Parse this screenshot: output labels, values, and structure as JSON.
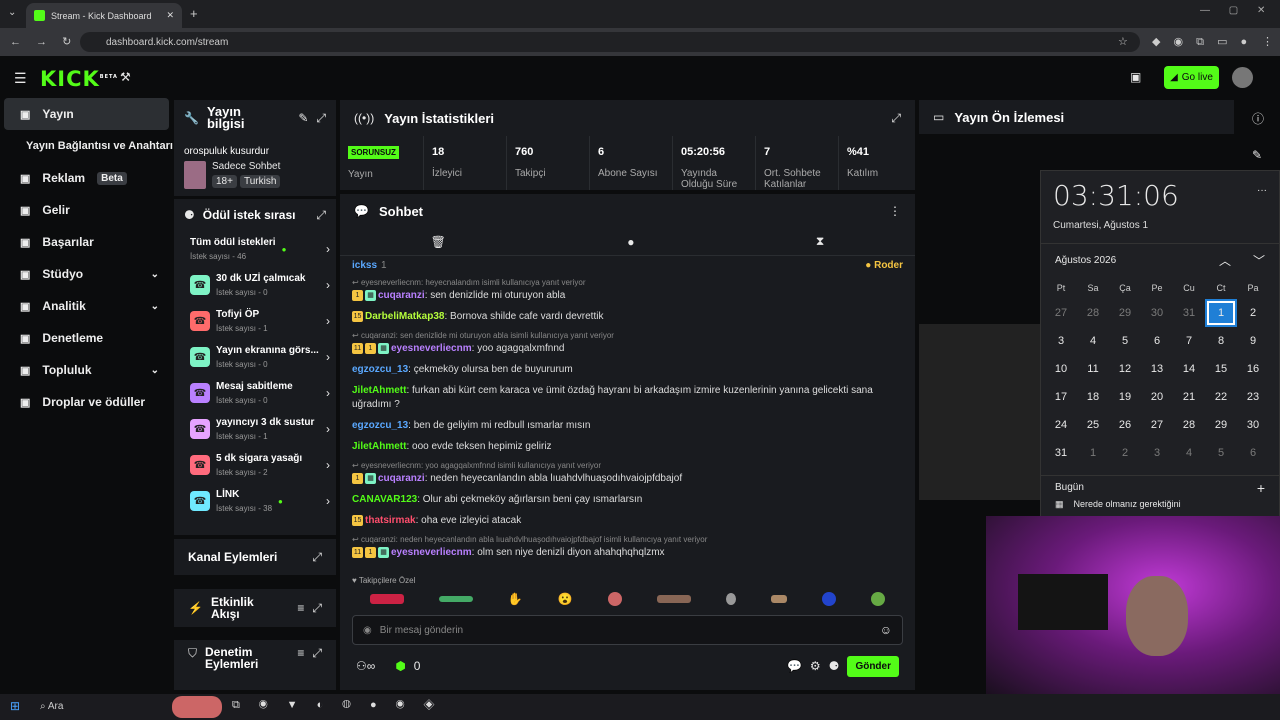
{
  "browser": {
    "tab_title": "Stream - Kick Dashboard",
    "url": "dashboard.kick.com/stream"
  },
  "header": {
    "logo": "KICK",
    "logo_sup": "BETA",
    "go_live": "Go live"
  },
  "nav": {
    "items": [
      {
        "label": "Yayın",
        "icon": "broadcast-icon",
        "active": true
      },
      {
        "label": "Yayın Bağlantısı ve Anahtarı",
        "icon": "",
        "sub": true
      },
      {
        "label": "Reklam",
        "icon": "ad-icon",
        "badge": "Beta"
      },
      {
        "label": "Gelir",
        "icon": "revenue-icon"
      },
      {
        "label": "Başarılar",
        "icon": "trophy-icon"
      },
      {
        "label": "Stüdyo",
        "icon": "studio-icon",
        "chevron": true
      },
      {
        "label": "Analitik",
        "icon": "analytics-icon",
        "chevron": true
      },
      {
        "label": "Denetleme",
        "icon": "wrench-icon"
      },
      {
        "label": "Topluluk",
        "icon": "community-icon",
        "chevron": true
      },
      {
        "label": "Droplar ve ödüller",
        "icon": "drops-icon"
      }
    ]
  },
  "stream_info": {
    "title": "Yayın bilgisi",
    "stream_title": "orospuluk kusurdur",
    "category": "Sadece Sohbet",
    "tags": [
      "18+",
      "Turkish"
    ]
  },
  "rewards": {
    "title": "Ödül istek sırası",
    "items": [
      {
        "name": "Tüm ödül istekleri",
        "sub": "İstek sayısı - 46",
        "color": "",
        "dot": true
      },
      {
        "name": "30 dk UZİ çalmıcak",
        "sub": "İstek sayısı - 0",
        "color": "#7ef3c5"
      },
      {
        "name": "Tofiyi ÖP",
        "sub": "İstek sayısı - 1",
        "color": "#ff6b6b"
      },
      {
        "name": "Yayın ekranına görs...",
        "sub": "İstek sayısı - 0",
        "color": "#7ef3c5"
      },
      {
        "name": "Mesaj sabitleme",
        "sub": "İstek sayısı - 0",
        "color": "#b980ff"
      },
      {
        "name": "yayıncıyı 3 dk sustur",
        "sub": "İstek sayısı - 1",
        "color": "#e6a3ff"
      },
      {
        "name": "5 dk sigara yasağı",
        "sub": "İstek sayısı - 2",
        "color": "#ff6b7d"
      },
      {
        "name": "LİNK",
        "sub": "İstek sayısı - 38",
        "color": "#6fe9ff",
        "dot": true
      }
    ]
  },
  "channel_actions": {
    "title": "Kanal Eylemleri"
  },
  "activity": {
    "title": "Etkinlik Akışı"
  },
  "moderation": {
    "title": "Denetim Eylemleri"
  },
  "stats": {
    "title": "Yayın İstatistikleri",
    "items": [
      {
        "value": "SORUNSUZ",
        "label": "Yayın"
      },
      {
        "value": "18",
        "label": "İzleyici"
      },
      {
        "value": "760",
        "label": "Takipçi"
      },
      {
        "value": "6",
        "label": "Abone Sayısı"
      },
      {
        "value": "05:20:56",
        "label": "Yayında Olduğu Süre"
      },
      {
        "value": "7",
        "label": "Ort. Sohbete Katılanlar"
      },
      {
        "value": "%41",
        "label": "Katılım"
      }
    ]
  },
  "chat": {
    "title": "Sohbet",
    "pinned_user": "ickss",
    "pinned_count": "1",
    "pinned_role": "Roder",
    "followers_only": "Takipçilere Özel",
    "placeholder": "Bir mesaj gönderin",
    "send": "Gönder",
    "points": "0",
    "messages": [
      {
        "reply": "eyesneverliecnm: heyecnalandım isimli kullanıcıya yanıt veriyor",
        "user": "cuqaranzi",
        "color": "#b980ff",
        "text": "sen denizlide mi oturuyon abla",
        "badges": [
          "1",
          "b"
        ]
      },
      {
        "user": "DarbeliMatkap38",
        "color": "#b6ff3c",
        "text": "Bornova shilde cafe vardı devrettik",
        "badges": [
          "15"
        ]
      },
      {
        "reply": "cuqaranzi: sen denizlide mi oturuyon abla isimli kullanıcıya yanıt veriyor",
        "user": "eyesneverliecnm",
        "color": "#b980ff",
        "text": "yoo agagqalxmfnnd",
        "badges": [
          "11",
          "1",
          "b"
        ]
      },
      {
        "user": "egzozcu_13",
        "color": "#5aa8ff",
        "text": "çekmeköy olursa ben de buyururum",
        "badges": []
      },
      {
        "user": "JiletAhmett",
        "color": "#53fc18",
        "text": "furkan abi kürt cem karaca ve ümit özdağ hayranı bi arkadaşım izmire kuzenlerinin yanına gelicekti sana uğradımı ?",
        "badges": []
      },
      {
        "user": "egzozcu_13",
        "color": "#5aa8ff",
        "text": "ben de geliyim mi redbull ısmarlar mısın",
        "badges": []
      },
      {
        "user": "JiletAhmett",
        "color": "#53fc18",
        "text": "ooo evde teksen hepimiz geliriz",
        "badges": []
      },
      {
        "reply": "eyesneverliecnm: yoo agagqalxmfnnd isimli kullanıcıya yanıt veriyor",
        "user": "cuqaranzi",
        "color": "#b980ff",
        "text": "neden heyecanlandın abla lıuahdvlhuaşodıhvaiojpfdbajof",
        "badges": [
          "1",
          "b"
        ]
      },
      {
        "user": "CANAVAR123",
        "color": "#53fc18",
        "text": "Olur abi çekmeköy ağırlarsın beni çay ısmarlarsın",
        "badges": []
      },
      {
        "user": "thatsirmak",
        "color": "#ff4f6d",
        "text": "oha eve izleyici atacak",
        "badges": [
          "15"
        ]
      },
      {
        "reply": "cuqaranzi: neden heyecanlandın abla lıuahdvlhuaşodıhvaiojpfdbajof isimli kullanıcıya yanıt veriyor",
        "user": "eyesneverliecnm",
        "color": "#b980ff",
        "text": "olm sen niye denizli diyon ahahqhqhqlzmx",
        "badges": [
          "11",
          "1",
          "b"
        ]
      }
    ]
  },
  "preview": {
    "title": "Yayın Ön İzlemesi"
  },
  "calendar": {
    "time": "03:31:06",
    "date": "Cumartesi, Ağustos 1",
    "month": "Ağustos 2026",
    "days": [
      "Pt",
      "Sa",
      "Ça",
      "Pe",
      "Cu",
      "Ct",
      "Pa"
    ],
    "weeks": [
      [
        "27",
        "28",
        "29",
        "30",
        "31",
        "1",
        "2"
      ],
      [
        "3",
        "4",
        "5",
        "6",
        "7",
        "8",
        "9"
      ],
      [
        "10",
        "11",
        "12",
        "13",
        "14",
        "15",
        "16"
      ],
      [
        "17",
        "18",
        "19",
        "20",
        "21",
        "22",
        "23"
      ],
      [
        "24",
        "25",
        "26",
        "27",
        "28",
        "29",
        "30"
      ],
      [
        "31",
        "1",
        "2",
        "3",
        "4",
        "5",
        "6"
      ]
    ],
    "today_label": "Bugün",
    "event": "Nerede olmanız gerektiğini"
  },
  "taskbar": {
    "search": "Ara"
  },
  "colors": {
    "accent": "#53fc18",
    "panel": "#191b1f",
    "bg": "#0b0c0d"
  }
}
